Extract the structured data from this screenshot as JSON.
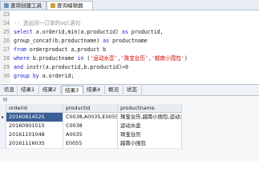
{
  "top_tabs": [
    "查询创建工具",
    "查询编辑器"
  ],
  "editor": {
    "lines": [
      {
        "num": "23",
        "parts": []
      },
      {
        "num": "24",
        "parts": [
          {
            "t": "-- 选出同一订单的sql语句",
            "c": "cmt"
          }
        ]
      },
      {
        "num": "25",
        "parts": [
          {
            "t": "select ",
            "c": "kw"
          },
          {
            "t": "a.orderid,min(a.productid) ",
            "c": "txt"
          },
          {
            "t": "as ",
            "c": "kw"
          },
          {
            "t": "productid,",
            "c": "txt"
          }
        ]
      },
      {
        "num": "26",
        "parts": [
          {
            "t": "group_concat(b.productname) ",
            "c": "txt"
          },
          {
            "t": "as ",
            "c": "kw"
          },
          {
            "t": "productname",
            "c": "txt"
          }
        ]
      },
      {
        "num": "27",
        "parts": [
          {
            "t": "from ",
            "c": "kw"
          },
          {
            "t": "orderproduct a,product b",
            "c": "txt"
          }
        ]
      },
      {
        "num": "28",
        "parts": [
          {
            "t": "where ",
            "c": "kw"
          },
          {
            "t": "b.productname ",
            "c": "txt"
          },
          {
            "t": "in ",
            "c": "kw"
          },
          {
            "t": "(",
            "c": "txt"
          },
          {
            "t": "'运动水壶'",
            "c": "str"
          },
          {
            "t": ",",
            "c": "txt"
          },
          {
            "t": "'珠宝台历'",
            "c": "str"
          },
          {
            "t": ",",
            "c": "txt"
          },
          {
            "t": "'越南小围包'",
            "c": "str"
          },
          {
            "t": ")",
            "c": "txt"
          }
        ]
      },
      {
        "num": "29",
        "parts": [
          {
            "t": "and ",
            "c": "kw"
          },
          {
            "t": "instr(a.productid,b.productid)>0",
            "c": "txt"
          }
        ]
      },
      {
        "num": "30",
        "parts": [
          {
            "t": "group by ",
            "c": "kw"
          },
          {
            "t": "a.orderid;",
            "c": "txt"
          }
        ]
      }
    ]
  },
  "result_tabs": [
    "信息",
    "结果1",
    "结果2",
    "结果3",
    "结果4",
    "概况",
    "状态"
  ],
  "active_result_tab": 3,
  "grid": {
    "columns": [
      "orderid",
      "productid",
      "productname"
    ],
    "rows": [
      [
        "20160814525",
        "C0038,A0035,E0055",
        "珠宝台历,越南小围包,运动水壶"
      ],
      [
        "20160901515",
        "C0038",
        "运动水壶"
      ],
      [
        "20161101048",
        "A0035",
        "珠宝台历"
      ],
      [
        "20161116035",
        "E0055",
        "越南小围包"
      ]
    ]
  },
  "colors": {
    "keyword": "#1b1bd6",
    "string": "#d00000",
    "comment": "#8c8c8c",
    "selection": "#3a5f94"
  }
}
